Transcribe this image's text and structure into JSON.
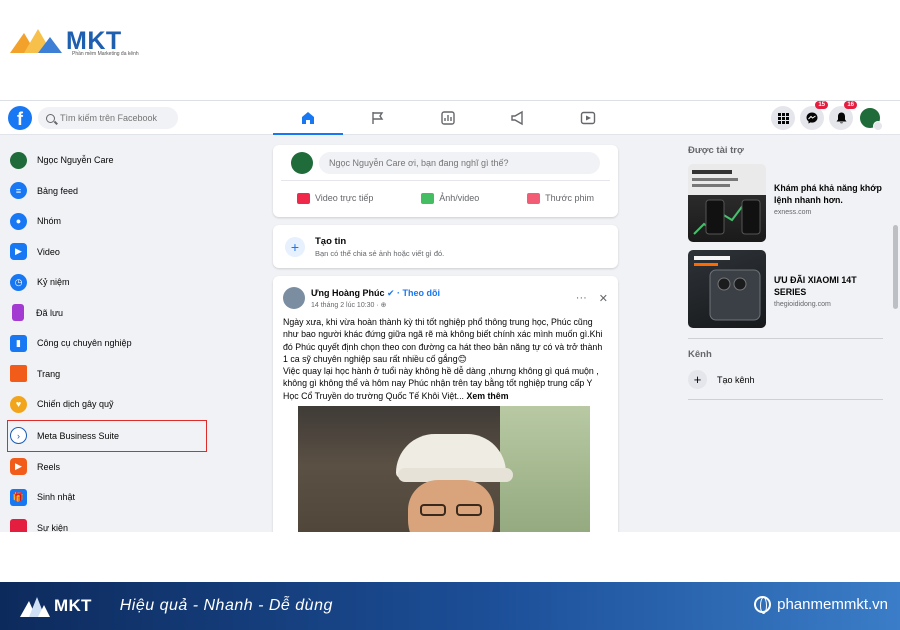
{
  "brand": {
    "name": "MKT",
    "tagline": "Phần mềm Marketing đa kênh"
  },
  "topbar": {
    "search_placeholder": "Tìm kiếm trên Facebook",
    "messenger_badge": "15",
    "notifications_badge": "16"
  },
  "sidebar": {
    "items": [
      {
        "label": "Ngọc Nguyễn Care",
        "icon": "profile-avatar",
        "color": "#1f6b3a"
      },
      {
        "label": "Bảng feed",
        "icon": "feed-icon",
        "color": "#1877f2"
      },
      {
        "label": "Nhóm",
        "icon": "groups-icon",
        "color": "#1877f2"
      },
      {
        "label": "Video",
        "icon": "video-icon",
        "color": "#1877f2"
      },
      {
        "label": "Kỷ niệm",
        "icon": "memories-icon",
        "color": "#1877f2"
      },
      {
        "label": "Đã lưu",
        "icon": "saved-icon",
        "color": "#a33ad1"
      },
      {
        "label": "Công cụ chuyên nghiệp",
        "icon": "pro-tools-icon",
        "color": "#1877f2"
      },
      {
        "label": "Trang",
        "icon": "pages-icon",
        "color": "#f25c1a"
      },
      {
        "label": "Chiến dịch gây quỹ",
        "icon": "fundraiser-icon",
        "color": "#f2a51a"
      },
      {
        "label": "Meta Business Suite",
        "icon": "business-suite-icon",
        "color": "#1c5bb5"
      },
      {
        "label": "Reels",
        "icon": "reels-icon",
        "color": "#f25c1a"
      },
      {
        "label": "Sinh nhật",
        "icon": "birthday-icon",
        "color": "#1877f2"
      },
      {
        "label": "Sự kiện",
        "icon": "events-icon",
        "color": "#e41e3f"
      }
    ]
  },
  "composer": {
    "placeholder": "Ngọc Nguyễn Care ơi, bạn đang nghĩ gì thế?",
    "live_label": "Video trực tiếp",
    "photo_label": "Ảnh/video",
    "movie_label": "Thước phim"
  },
  "create_story": {
    "title": "Tạo tin",
    "subtitle": "Bạn có thể chia sẻ ảnh hoặc viết gì đó."
  },
  "post": {
    "author": "Ưng Hoàng Phúc",
    "follow_label": "· Theo dõi",
    "time": "14 tháng 2 lúc 10:30 ·",
    "paragraph1": "Ngày xưa, khi vừa hoàn thành kỳ thi tốt nghiệp phổ thông trung học, Phúc cũng như bao người khác đứng giữa ngã rẽ mà không biết chính xác mình muốn gì.Khi đó Phúc quyết định chọn theo con đường ca hát theo bản năng tự có và trở thành 1 ca sỹ chuyên nghiệp sau rất nhiều cố gắng😊",
    "paragraph2": "Việc quay lại học hành ở tuổi này không hề dễ dàng ,nhưng không gì quá muộn , không gì không thể và hôm nay Phúc nhận trên tay bằng tốt nghiệp trung cấp Y Học Cổ Truyền do trường Quốc Tế Khôi Việt...",
    "see_more": "Xem thêm"
  },
  "right": {
    "sponsored_label": "Được tài trợ",
    "ads": [
      {
        "title": "Khám phá khả năng khớp lệnh nhanh hơn.",
        "source": "exness.com"
      },
      {
        "title": "ƯU ĐÃI XIAOMI 14T SERIES",
        "source": "thegioididong.com"
      }
    ],
    "channels_label": "Kênh",
    "create_channel": "Tạo kênh"
  },
  "banner": {
    "logo": "MKT",
    "slogan": "Hiệu quả - Nhanh  - Dễ dùng",
    "url": "phanmemmkt.vn"
  },
  "colors": {
    "facebook_blue": "#1877f2",
    "highlight_red": "#e02b2b",
    "banner_dark": "#0d2a5c"
  }
}
